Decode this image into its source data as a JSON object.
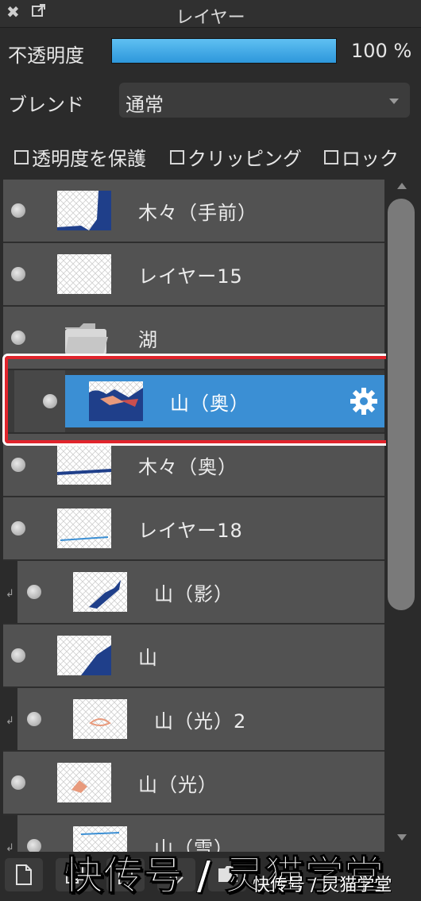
{
  "panel": {
    "title": "レイヤー",
    "close_glyph": "✖"
  },
  "opacity": {
    "label": "不透明度",
    "value": "100 %",
    "fraction": 1.0
  },
  "blend": {
    "label": "ブレンド",
    "value": "通常"
  },
  "checkboxes": [
    {
      "label": "透明度を保護",
      "checked": false
    },
    {
      "label": "クリッピング",
      "checked": false
    },
    {
      "label": "ロック",
      "checked": false
    }
  ],
  "layers": [
    {
      "name": "木々（手前）",
      "type": "layer",
      "clipped": false,
      "selected": false
    },
    {
      "name": "レイヤー15",
      "type": "layer",
      "clipped": false,
      "selected": false
    },
    {
      "name": "湖",
      "type": "folder",
      "clipped": false,
      "selected": false
    },
    {
      "name": "山（奥）",
      "type": "layer",
      "clipped": false,
      "selected": true
    },
    {
      "name": "木々（奥）",
      "type": "layer",
      "clipped": false,
      "selected": false
    },
    {
      "name": "レイヤー18",
      "type": "layer",
      "clipped": false,
      "selected": false
    },
    {
      "name": "山（影）",
      "type": "layer",
      "clipped": true,
      "selected": false
    },
    {
      "name": "山",
      "type": "layer",
      "clipped": false,
      "selected": false
    },
    {
      "name": "山（光）2",
      "type": "layer",
      "clipped": true,
      "selected": false
    },
    {
      "name": "山（光）",
      "type": "layer",
      "clipped": false,
      "selected": false
    },
    {
      "name": "山（雪）",
      "type": "layer",
      "clipped": true,
      "selected": false
    }
  ],
  "toolbar": {
    "buttons": [
      "new-layer-icon",
      "duplicate-icon",
      "delete-icon",
      "folder-icon",
      "menu-icon"
    ]
  },
  "watermark": {
    "main": "快传号 / 灵猫学堂",
    "sub": "快传号 / 灵猫学堂"
  },
  "colors": {
    "accent": "#3b8fd4",
    "highlight": "#e0242c",
    "row": "#525252"
  }
}
